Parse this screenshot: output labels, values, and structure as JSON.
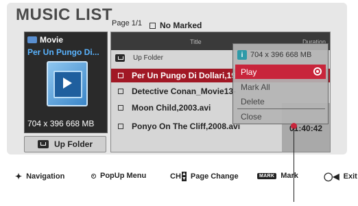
{
  "header": {
    "title": "MUSIC LIST",
    "page_info": "Page 1/1",
    "marked_status": "No Marked"
  },
  "preview": {
    "category": "Movie",
    "filename": "Per Un Pungo Di...",
    "resolution": "704 x 396  668 MB"
  },
  "up_folder_button": "Up Folder",
  "list": {
    "columns": {
      "title": "Title",
      "duration": "Duration"
    },
    "up_folder_row": "Up Folder",
    "rows": [
      {
        "title": "Per Un Pungo Di Dollari,1964.avi",
        "selected": true
      },
      {
        "title": "Detective Conan_Movie13-",
        "selected": false
      },
      {
        "title": "Moon Child,2003.avi",
        "selected": false
      },
      {
        "title": "Ponyo On The Cliff,2008.avi",
        "selected": false
      }
    ],
    "visible_duration": "01:40:42"
  },
  "popup": {
    "info_icon": "i",
    "info": "704 x 396  668 MB",
    "items": [
      "Play",
      "Mark All",
      "Delete",
      "Close"
    ],
    "active_item": "Play"
  },
  "footer": {
    "navigation": "Navigation",
    "popup_menu": "PopUp Menu",
    "ch_label": "CH",
    "page_change": "Page Change",
    "mark_badge": "MARK",
    "mark": "Mark",
    "exit": "Exit"
  },
  "colors": {
    "selection": "#a11825",
    "popup_active": "#c8253b",
    "preview_filename": "#5ab4ff"
  }
}
